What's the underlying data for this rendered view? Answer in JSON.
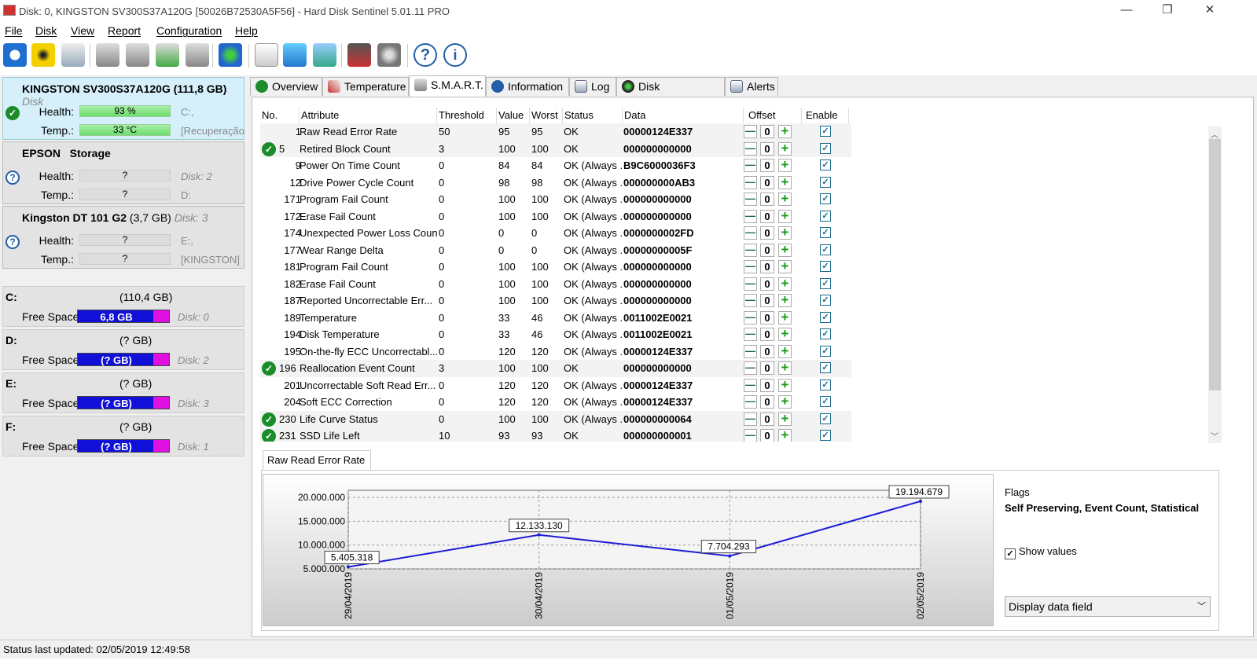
{
  "window": {
    "title": "Disk: 0, KINGSTON SV300S37A120G [50026B72530A5F56]  -  Hard Disk Sentinel 5.01.11 PRO",
    "minimize": "—",
    "restore": "❐",
    "close": "✕"
  },
  "menu": [
    "File",
    "Disk",
    "View",
    "Report",
    "Configuration",
    "Help"
  ],
  "disks": [
    {
      "name": "KINGSTON SV300S37A120G",
      "size": "(111,8 GB)",
      "extra": "Disk",
      "health": "93 %",
      "temp": "33 °C",
      "side1": "C:,",
      "side2": "[Recuperação"
    },
    {
      "name": "EPSON   Storage",
      "size": "",
      "extra": "",
      "health": "?",
      "temp": "?",
      "side1": "Disk: 2",
      "side2": "D:"
    },
    {
      "name": "Kingston DT 101 G2",
      "size": "(3,7 GB)",
      "extra": "Disk: 3",
      "health": "?",
      "temp": "?",
      "side1": "E:,",
      "side2": "[KINGSTON]"
    }
  ],
  "labels": {
    "health": "Health:",
    "temp": "Temp.:",
    "free": "Free Space"
  },
  "volumes": [
    {
      "letter": "C:",
      "size": "(110,4 GB)",
      "free": "6,8 GB",
      "disk": "Disk: 0"
    },
    {
      "letter": "D:",
      "size": "(? GB)",
      "free": "(? GB)",
      "disk": "Disk: 2"
    },
    {
      "letter": "E:",
      "size": "(? GB)",
      "free": "(? GB)",
      "disk": "Disk: 3"
    },
    {
      "letter": "F:",
      "size": "(? GB)",
      "free": "(? GB)",
      "disk": "Disk: 1"
    }
  ],
  "status": "Status last updated: 02/05/2019 12:49:58",
  "tabs": [
    "Overview",
    "Temperature",
    "S.M.A.R.T.",
    "Information",
    "Log",
    "Disk Performance",
    "Alerts"
  ],
  "columns": [
    "No.",
    "Attribute",
    "Threshold",
    "Value",
    "Worst",
    "Status",
    "Data",
    "Offset",
    "Enable"
  ],
  "rows": [
    {
      "no": "1",
      "ok": false,
      "attr": "Raw Read Error Rate",
      "thr": "50",
      "val": "95",
      "worst": "95",
      "status": "OK",
      "data": "00000124E337",
      "offset": "0"
    },
    {
      "no": "5",
      "ok": true,
      "attr": "Retired Block Count",
      "thr": "3",
      "val": "100",
      "worst": "100",
      "status": "OK",
      "data": "000000000000",
      "offset": "0"
    },
    {
      "no": "9",
      "ok": false,
      "attr": "Power On Time Count",
      "thr": "0",
      "val": "84",
      "worst": "84",
      "status": "OK (Always ...",
      "data": "B9C6000036F3",
      "offset": "0"
    },
    {
      "no": "12",
      "ok": false,
      "attr": "Drive Power Cycle Count",
      "thr": "0",
      "val": "98",
      "worst": "98",
      "status": "OK (Always ...",
      "data": "000000000AB3",
      "offset": "0"
    },
    {
      "no": "171",
      "ok": false,
      "attr": "Program Fail Count",
      "thr": "0",
      "val": "100",
      "worst": "100",
      "status": "OK (Always ...",
      "data": "000000000000",
      "offset": "0"
    },
    {
      "no": "172",
      "ok": false,
      "attr": "Erase Fail Count",
      "thr": "0",
      "val": "100",
      "worst": "100",
      "status": "OK (Always ...",
      "data": "000000000000",
      "offset": "0"
    },
    {
      "no": "174",
      "ok": false,
      "attr": "Unexpected Power Loss Count",
      "thr": "0",
      "val": "0",
      "worst": "0",
      "status": "OK (Always ...",
      "data": "0000000002FD",
      "offset": "0"
    },
    {
      "no": "177",
      "ok": false,
      "attr": "Wear Range Delta",
      "thr": "0",
      "val": "0",
      "worst": "0",
      "status": "OK (Always ...",
      "data": "00000000005F",
      "offset": "0"
    },
    {
      "no": "181",
      "ok": false,
      "attr": "Program Fail Count",
      "thr": "0",
      "val": "100",
      "worst": "100",
      "status": "OK (Always ...",
      "data": "000000000000",
      "offset": "0"
    },
    {
      "no": "182",
      "ok": false,
      "attr": "Erase Fail Count",
      "thr": "0",
      "val": "100",
      "worst": "100",
      "status": "OK (Always ...",
      "data": "000000000000",
      "offset": "0"
    },
    {
      "no": "187",
      "ok": false,
      "attr": "Reported Uncorrectable Err...",
      "thr": "0",
      "val": "100",
      "worst": "100",
      "status": "OK (Always ...",
      "data": "000000000000",
      "offset": "0"
    },
    {
      "no": "189",
      "ok": false,
      "attr": "Temperature",
      "thr": "0",
      "val": "33",
      "worst": "46",
      "status": "OK (Always ...",
      "data": "0011002E0021",
      "offset": "0"
    },
    {
      "no": "194",
      "ok": false,
      "attr": "Disk Temperature",
      "thr": "0",
      "val": "33",
      "worst": "46",
      "status": "OK (Always ...",
      "data": "0011002E0021",
      "offset": "0"
    },
    {
      "no": "195",
      "ok": false,
      "attr": "On-the-fly ECC Uncorrectabl...",
      "thr": "0",
      "val": "120",
      "worst": "120",
      "status": "OK (Always ...",
      "data": "00000124E337",
      "offset": "0"
    },
    {
      "no": "196",
      "ok": true,
      "attr": "Reallocation Event Count",
      "thr": "3",
      "val": "100",
      "worst": "100",
      "status": "OK",
      "data": "000000000000",
      "offset": "0"
    },
    {
      "no": "201",
      "ok": false,
      "attr": "Uncorrectable Soft Read Err...",
      "thr": "0",
      "val": "120",
      "worst": "120",
      "status": "OK (Always ...",
      "data": "00000124E337",
      "offset": "0"
    },
    {
      "no": "204",
      "ok": false,
      "attr": "Soft ECC Correction",
      "thr": "0",
      "val": "120",
      "worst": "120",
      "status": "OK (Always ...",
      "data": "00000124E337",
      "offset": "0"
    },
    {
      "no": "230",
      "ok": true,
      "attr": "Life Curve Status",
      "thr": "0",
      "val": "100",
      "worst": "100",
      "status": "OK (Always ...",
      "data": "000000000064",
      "offset": "0"
    },
    {
      "no": "231",
      "ok": true,
      "attr": "SSD Life Left",
      "thr": "10",
      "val": "93",
      "worst": "93",
      "status": "OK",
      "data": "000000000001",
      "offset": "0"
    }
  ],
  "bottom_tab": "Raw Read Error Rate",
  "flags_label": "Flags",
  "flags_value": "Self Preserving, Event Count, Statistical",
  "show_values": "Show values",
  "display_select": "Display data field",
  "chart_data": {
    "type": "line",
    "x": [
      "29/04/2019",
      "30/04/2019",
      "01/05/2019",
      "02/05/2019"
    ],
    "values": [
      5405318,
      12133130,
      7704293,
      19194679
    ],
    "value_labels": [
      "5.405.318",
      "12.133.130",
      "7.704.293",
      "19.194.679"
    ],
    "yticks": [
      "5.000.000",
      "10.000.000",
      "15.000.000",
      "20.000.000"
    ],
    "ytick_values": [
      5000000,
      10000000,
      15000000,
      20000000
    ],
    "ylim": [
      5000000,
      21500000
    ],
    "grid": true,
    "line_color": "#1c1cd6"
  }
}
